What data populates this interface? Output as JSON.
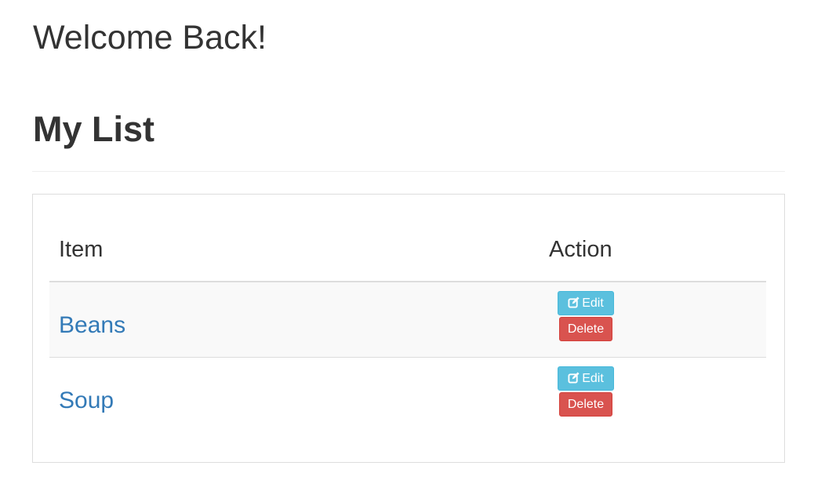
{
  "header": {
    "welcome": "Welcome Back!",
    "list_title": "My List"
  },
  "table": {
    "columns": [
      "Item",
      "Action"
    ],
    "rows": [
      {
        "item": "Beans",
        "edit_label": "Edit",
        "delete_label": "Delete"
      },
      {
        "item": "Soup",
        "edit_label": "Edit",
        "delete_label": "Delete"
      }
    ]
  },
  "colors": {
    "link": "#337ab7",
    "edit_button": "#5bc0de",
    "delete_button": "#d9534f",
    "text": "#333333"
  },
  "icons": {
    "edit": "edit-icon"
  }
}
